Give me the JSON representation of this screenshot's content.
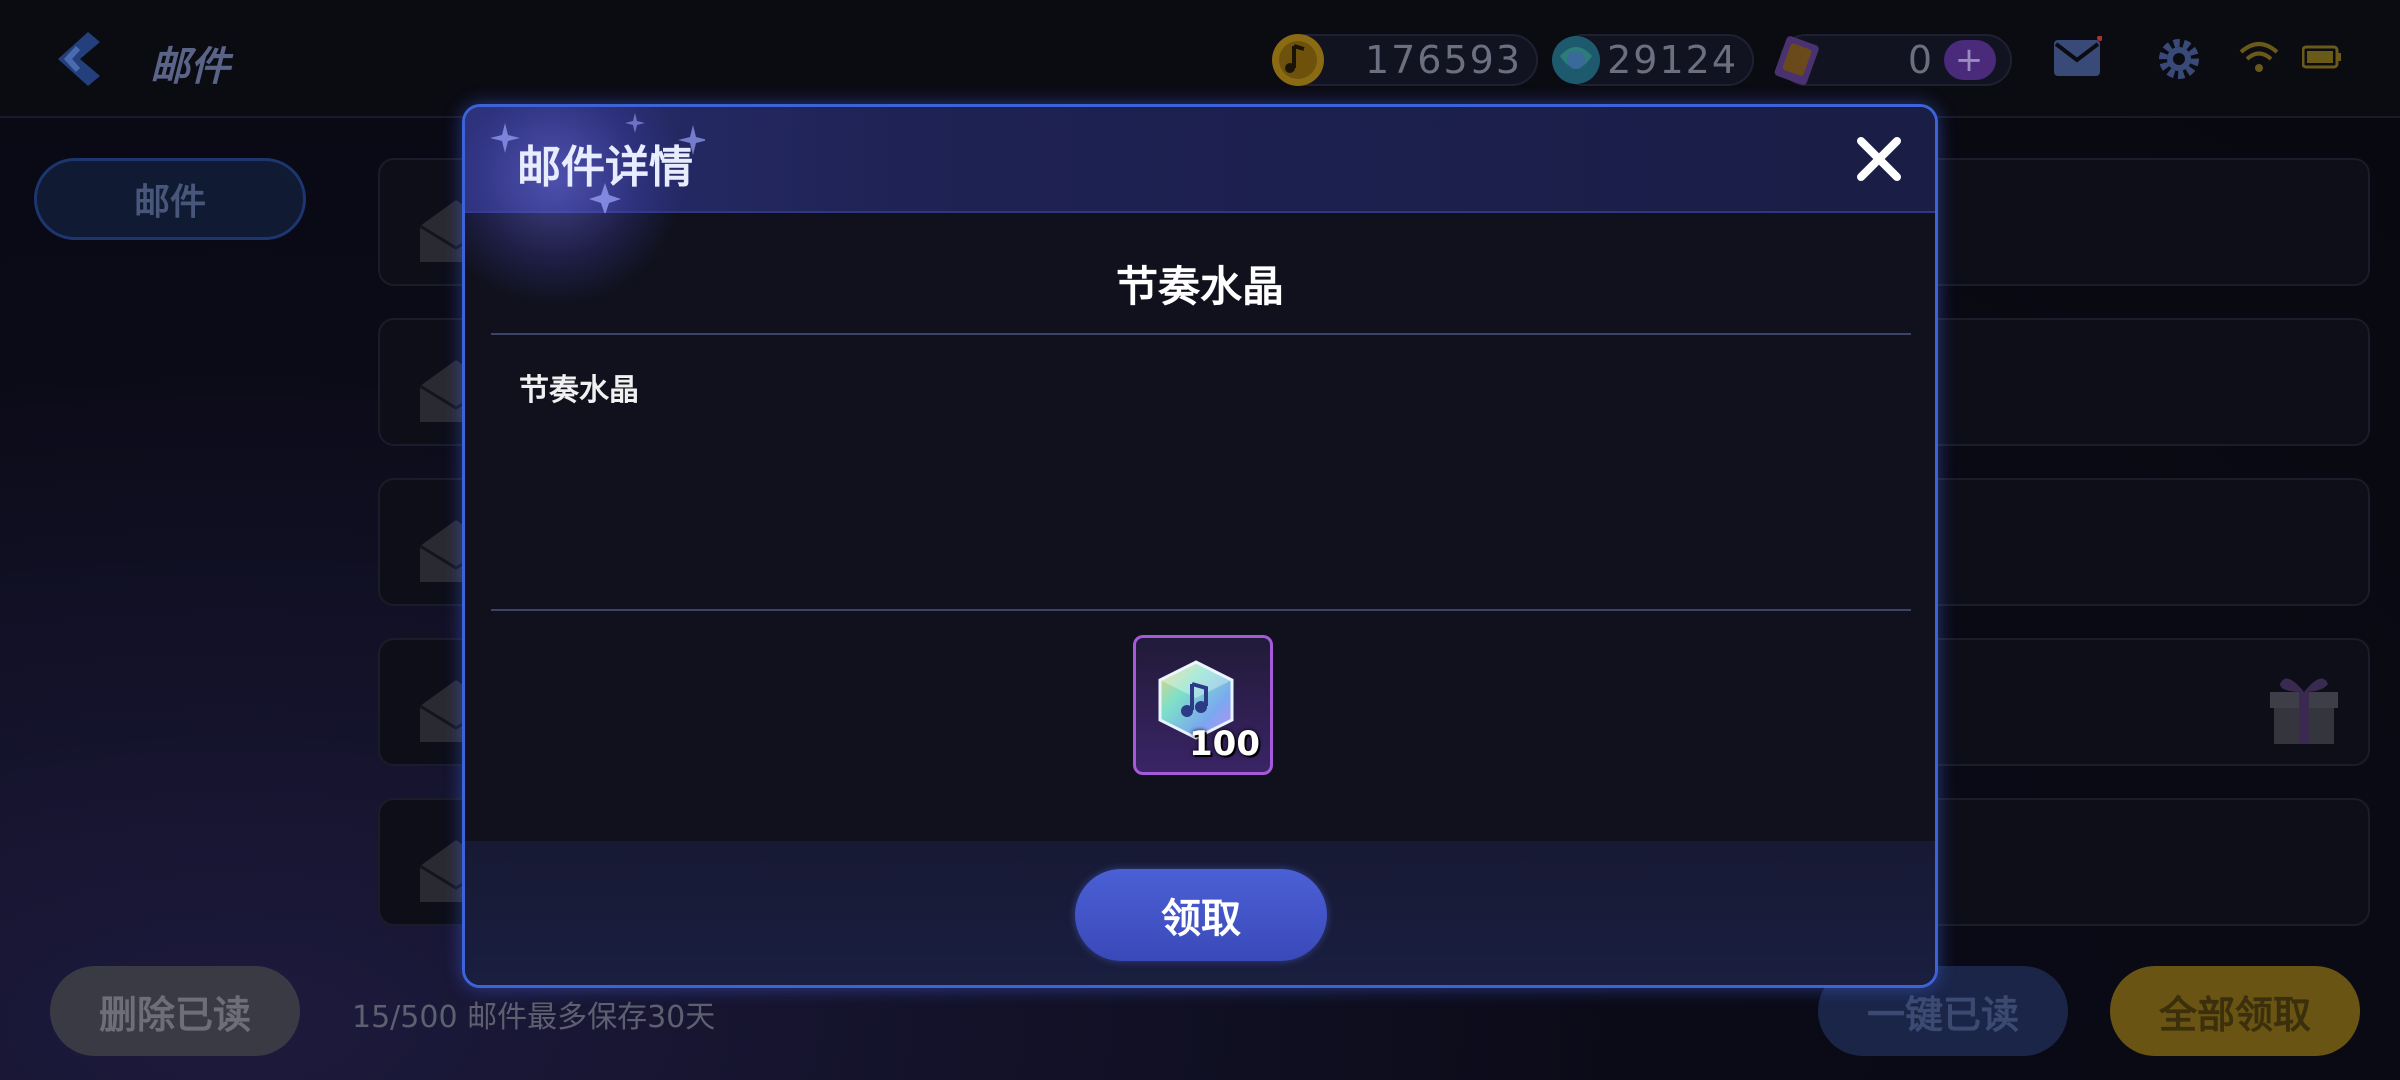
{
  "screen": {
    "title": "邮件",
    "resources": {
      "coins": "176593",
      "gems": "29124",
      "tickets": "0",
      "plus_symbol": "+"
    },
    "icons": [
      "back-arrow-icon",
      "coin-icon",
      "gem-icon",
      "ticket-icon",
      "mail-icon",
      "gear-icon",
      "wifi-icon",
      "battery-icon"
    ]
  },
  "sidebar": {
    "tab_label": "邮件"
  },
  "footer": {
    "delete_read_label": "删除已读",
    "info": "15/500 邮件最多保存30天",
    "mark_all_read_label": "一键已读",
    "claim_all_label": "全部领取"
  },
  "modal": {
    "title": "邮件详情",
    "subject": "节奏水晶",
    "body": "节奏水晶",
    "reward": {
      "item_icon": "rhythm-crystal-icon",
      "count": "100"
    },
    "claim_label": "领取"
  },
  "colors": {
    "modal_border": "#3d63d8",
    "claim_button": "#4559c8",
    "reward_border": "#a55ad8",
    "claim_all_button": "#6a5414"
  }
}
